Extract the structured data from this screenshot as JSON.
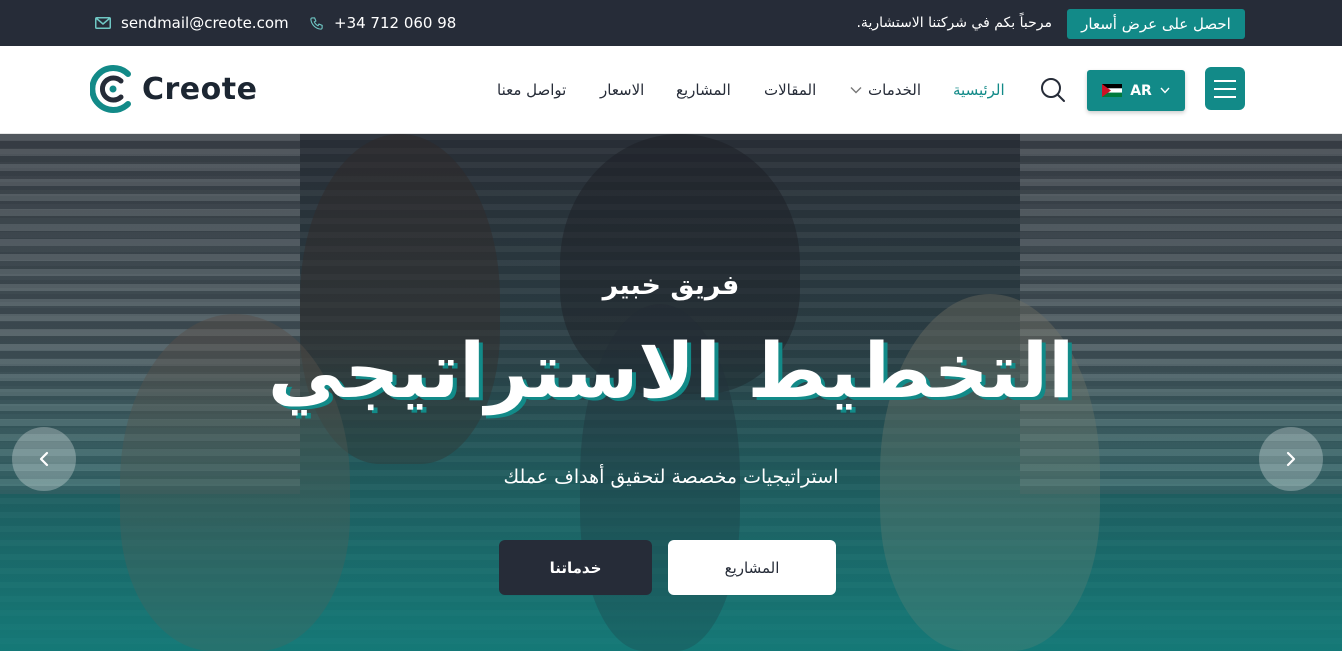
{
  "topbar": {
    "email": "sendmail@creote.com",
    "phone": "+34 712 060 98",
    "welcome": "مرحباً بكم في شركتنا الاستشارية.",
    "quote_button": "احصل على عرض أسعار"
  },
  "header": {
    "logo_text": "Creote",
    "nav": {
      "home": "الرئيسية",
      "services": "الخدمات",
      "articles": "المقالات",
      "projects": "المشاريع",
      "prices": "الاسعار",
      "contact": "تواصل معنا"
    },
    "language": "AR"
  },
  "hero": {
    "subtitle": "فريق خبير",
    "title": "التخطيط الاستراتيجي",
    "tagline": "استراتيجيات مخصصة لتحقيق أهداف عملك",
    "projects_button": "المشاريع",
    "services_button": "خدماتنا"
  },
  "colors": {
    "accent": "#128a88",
    "dark": "#262c38"
  }
}
